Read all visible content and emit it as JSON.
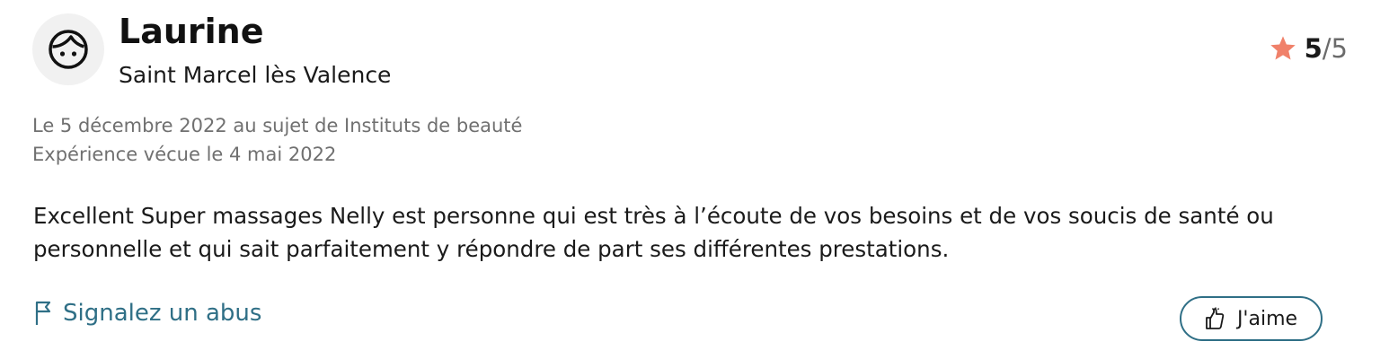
{
  "review": {
    "author": {
      "name": "Laurine",
      "location": "Saint Marcel lès Valence",
      "avatar_icon": "face-icon"
    },
    "rating": {
      "score": "5",
      "separator_max": "/5",
      "star_color": "#f0816a"
    },
    "meta": {
      "date_line": "Le 5 décembre 2022 au sujet de Instituts de beauté",
      "experience_line": "Expérience vécue le 4 mai 2022"
    },
    "text": "Excellent Super massages Nelly est personne qui est très à l’écoute de vos besoins et de vos soucis de santé ou personnelle et qui sait parfaitement y répondre de part ses différentes prestations.",
    "actions": {
      "report_label": "Signalez un abus",
      "report_icon": "flag-icon",
      "like_label": "J'aime",
      "like_icon": "thumbs-up-icon",
      "accent_color": "#2f6f86"
    }
  }
}
